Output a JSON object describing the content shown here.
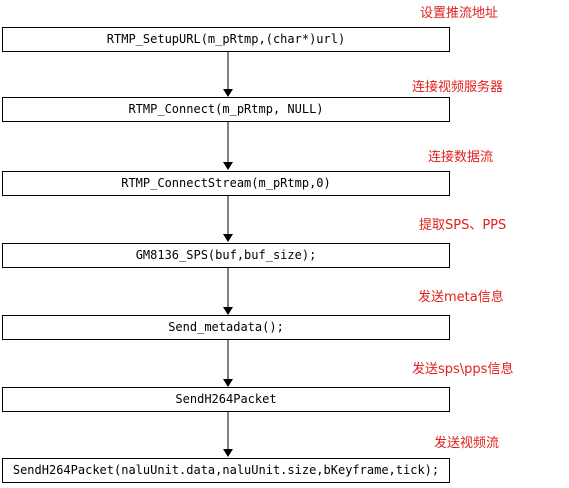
{
  "colors": {
    "box_border": "#000000",
    "box_text": "#000000",
    "annotation": "#e0201c",
    "arrow": "#000000",
    "background": "#ffffff"
  },
  "steps": [
    {
      "code": "RTMP_SetupURL(m_pRtmp,(char*)url)",
      "note": "设置推流地址"
    },
    {
      "code": "RTMP_Connect(m_pRtmp, NULL)",
      "note": "连接视频服务器"
    },
    {
      "code": "RTMP_ConnectStream(m_pRtmp,0)",
      "note": "连接数据流"
    },
    {
      "code": "GM8136_SPS(buf,buf_size);",
      "note": "提取SPS、PPS"
    },
    {
      "code": "Send_metadata();",
      "note": "发送meta信息"
    },
    {
      "code": "SendH264Packet",
      "note": "发送sps\\pps信息"
    },
    {
      "code": "SendH264Packet(naluUnit.data,naluUnit.size,bKeyframe,tick);",
      "note": "发送视频流"
    }
  ]
}
